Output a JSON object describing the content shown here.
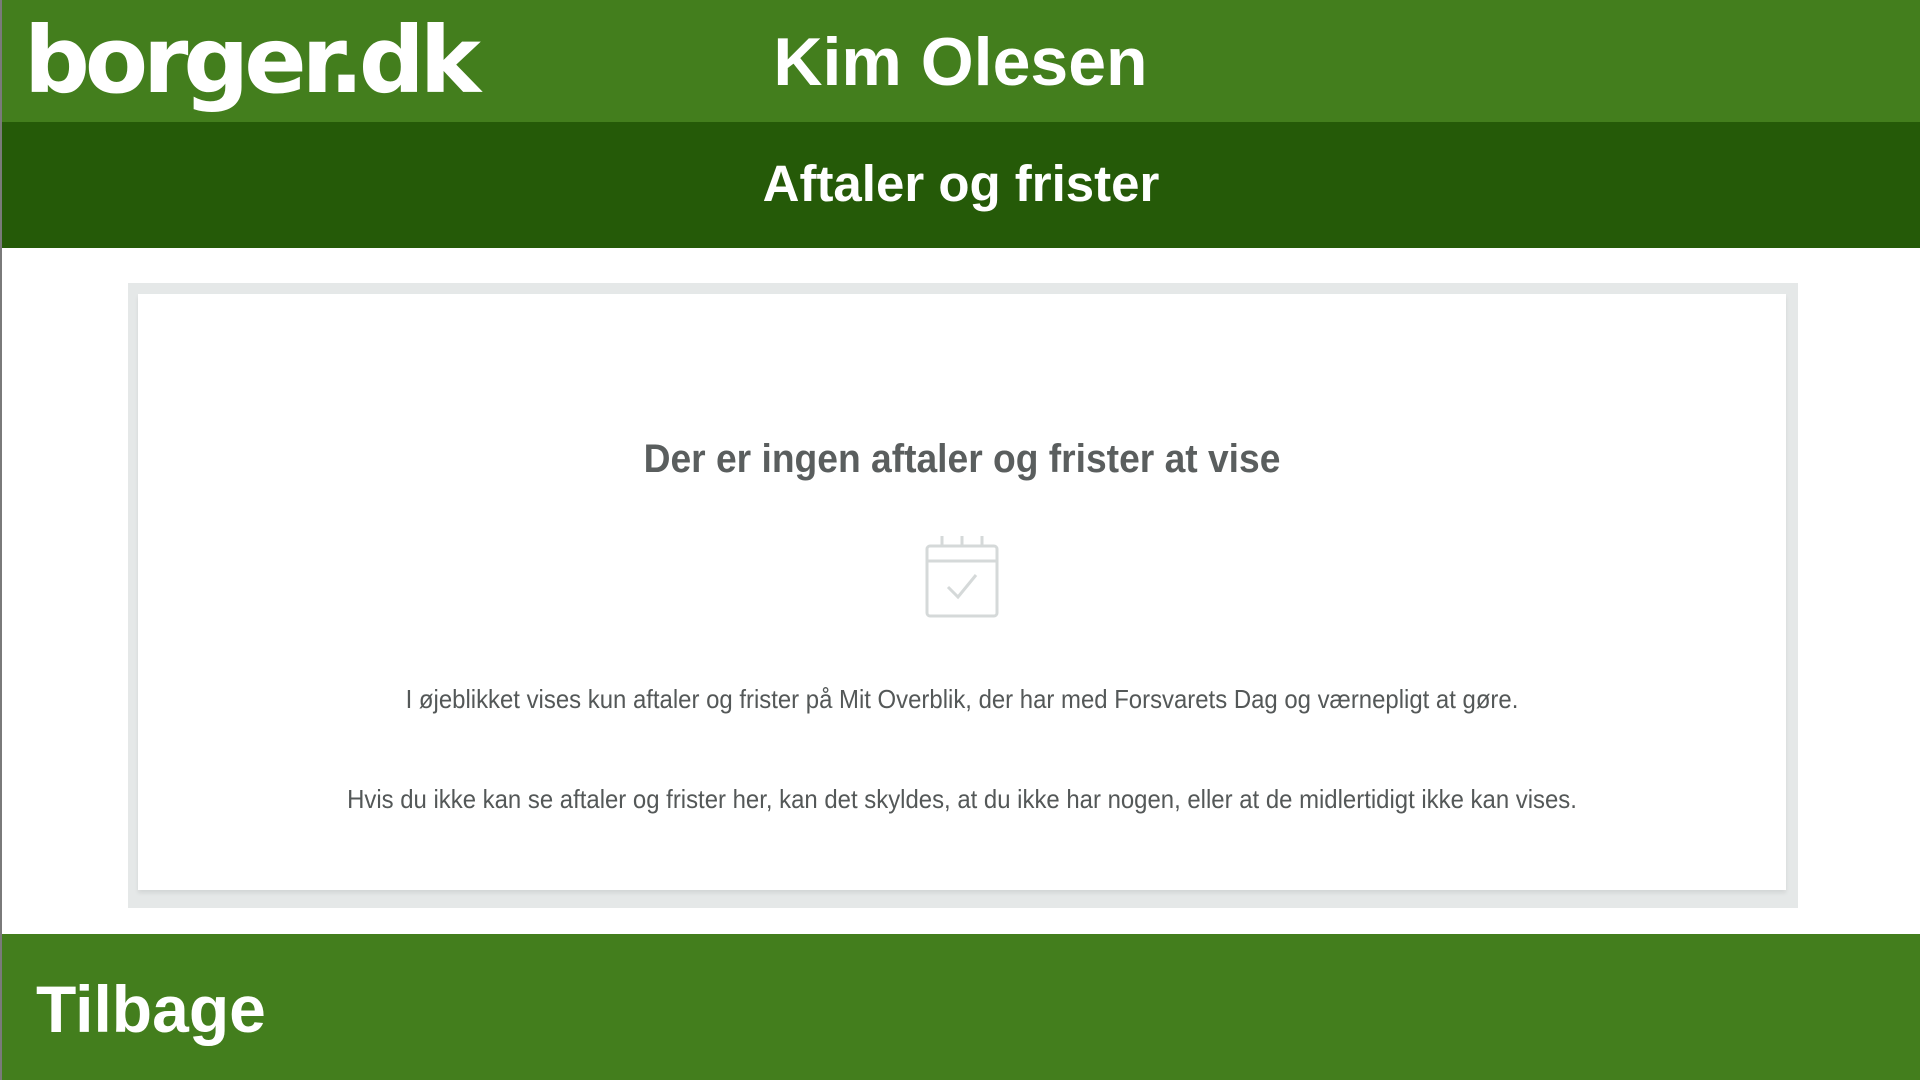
{
  "header": {
    "logo_text": "borger.dk",
    "user_name": "Kim Olesen",
    "background_color": "#437e1d"
  },
  "subheader": {
    "title": "Aftaler og frister",
    "background_color": "#255a08"
  },
  "main": {
    "empty_state": {
      "heading": "Der er ingen aftaler og frister at vise",
      "icon": "calendar-check-icon",
      "info_lines": [
        "I øjeblikket vises kun aftaler og frister på Mit Overblik, der har med Forsvarets Dag og værnepligt at gøre.",
        "Hvis du ikke kan se aftaler og frister her, kan det skyldes, at du ikke har nogen, eller at de midlertidigt ikke kan vises."
      ]
    }
  },
  "footer": {
    "back_label": "Tilbage",
    "background_color": "#437e1d"
  }
}
